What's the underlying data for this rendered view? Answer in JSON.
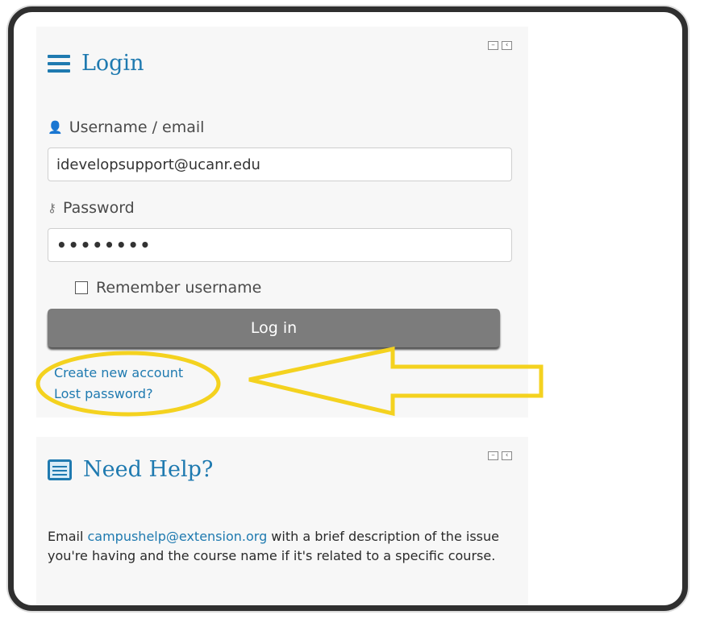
{
  "login": {
    "title": "Login",
    "username_label": "Username / email",
    "username_value": "idevelopsupport@ucanr.edu",
    "password_label": "Password",
    "password_value": "••••••••",
    "remember_label": "Remember username",
    "login_button": "Log in",
    "create_account": "Create new account",
    "lost_password": "Lost password?"
  },
  "help": {
    "title": "Need Help?",
    "text_prefix": "Email ",
    "email": "campushelp@extension.org",
    "text_suffix": " with a brief description of the issue you're having and the course name if it's related to a specific course."
  },
  "icons": {
    "menu": "hamburger-icon",
    "user": "user-icon",
    "key": "key-icon",
    "help": "list-icon",
    "collapse": "minus-icon",
    "dock": "chevron-left-icon"
  },
  "colors": {
    "accent": "#1f7ab0",
    "button": "#7c7c7c",
    "highlight": "#f4d21f"
  }
}
